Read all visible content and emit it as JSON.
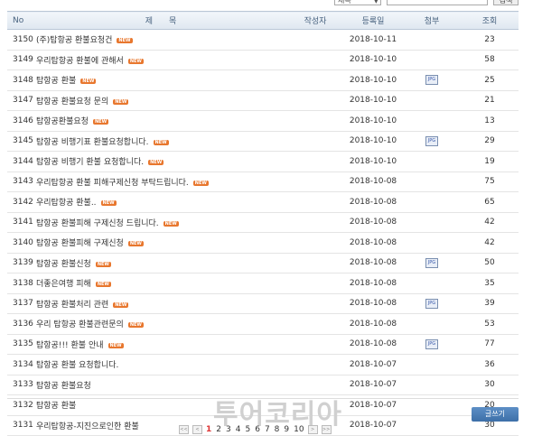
{
  "search": {
    "field_select": "제목",
    "submit_label": "검색"
  },
  "table": {
    "headers": {
      "no": "No",
      "title": "제　　목",
      "author": "작성자",
      "date": "등록일",
      "attach": "첨부",
      "views": "조회"
    },
    "new_badge": "NEW",
    "file_icon": "JPG",
    "rows": [
      {
        "no": "3150",
        "title": "(주)탑항공 환불요청건",
        "new": true,
        "date": "2018-10-11",
        "attach": false,
        "views": "23"
      },
      {
        "no": "3149",
        "title": "우리탑항공 환불에 관해서",
        "new": true,
        "date": "2018-10-10",
        "attach": false,
        "views": "58"
      },
      {
        "no": "3148",
        "title": "탑항공 환불",
        "new": true,
        "date": "2018-10-10",
        "attach": true,
        "views": "25"
      },
      {
        "no": "3147",
        "title": "탑항공 환불요청 문의",
        "new": true,
        "date": "2018-10-10",
        "attach": false,
        "views": "21"
      },
      {
        "no": "3146",
        "title": "탑항공환불요청",
        "new": true,
        "date": "2018-10-10",
        "attach": false,
        "views": "13"
      },
      {
        "no": "3145",
        "title": "탑항공 비행기표 환불요청합니다.",
        "new": true,
        "date": "2018-10-10",
        "attach": true,
        "views": "29"
      },
      {
        "no": "3144",
        "title": "탑항공 비행기 환불 요청합니다.",
        "new": true,
        "date": "2018-10-10",
        "attach": false,
        "views": "19"
      },
      {
        "no": "3143",
        "title": "우리탑항공 환불 피해구제신청 부탁드립니다.",
        "new": true,
        "date": "2018-10-08",
        "attach": false,
        "views": "75"
      },
      {
        "no": "3142",
        "title": "우리탑항공 환불..",
        "new": true,
        "date": "2018-10-08",
        "attach": false,
        "views": "65"
      },
      {
        "no": "3141",
        "title": "탑항공 환불피해 구제신청 드립니다.",
        "new": true,
        "date": "2018-10-08",
        "attach": false,
        "views": "42"
      },
      {
        "no": "3140",
        "title": "탑항공 환불피해 구제신청",
        "new": true,
        "date": "2018-10-08",
        "attach": false,
        "views": "42"
      },
      {
        "no": "3139",
        "title": "탑항공 환불신청",
        "new": true,
        "date": "2018-10-08",
        "attach": true,
        "views": "50"
      },
      {
        "no": "3138",
        "title": "더좋은여행 피해",
        "new": true,
        "date": "2018-10-08",
        "attach": false,
        "views": "35"
      },
      {
        "no": "3137",
        "title": "탑항공 환불처리 관련",
        "new": true,
        "date": "2018-10-08",
        "attach": true,
        "views": "39"
      },
      {
        "no": "3136",
        "title": "우리 탑항공 환불관련문의",
        "new": true,
        "date": "2018-10-08",
        "attach": false,
        "views": "53"
      },
      {
        "no": "3135",
        "title": "탑항공!!! 환불 안내",
        "new": true,
        "date": "2018-10-08",
        "attach": true,
        "views": "77"
      },
      {
        "no": "3134",
        "title": "탑항공 환불 요청합니다.",
        "new": false,
        "date": "2018-10-07",
        "attach": false,
        "views": "36"
      },
      {
        "no": "3133",
        "title": "탑항공 환불요청",
        "new": false,
        "date": "2018-10-07",
        "attach": false,
        "views": "30"
      },
      {
        "no": "3132",
        "title": "탑항공 환불",
        "new": false,
        "date": "2018-10-07",
        "attach": false,
        "views": "20"
      },
      {
        "no": "3131",
        "title": "우리탑항공-지진으로인한 환불",
        "new": false,
        "date": "2018-10-07",
        "attach": false,
        "views": "30"
      }
    ]
  },
  "watermark": "투어코리아",
  "write_button": "글쓰기",
  "pagination": {
    "pages": [
      "1",
      "2",
      "3",
      "4",
      "5",
      "6",
      "7",
      "8",
      "9",
      "10"
    ],
    "current": "1",
    "first": "<<",
    "prev": "<",
    "next": ">",
    "last": ">>"
  },
  "colors": {
    "accent": "#4a7ab3",
    "new_badge": "#e8772e",
    "current_page": "#dd3333"
  }
}
